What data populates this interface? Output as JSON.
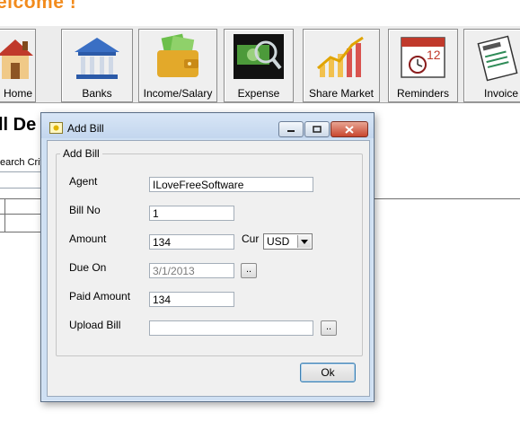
{
  "header": {
    "welcome_text": "elcome !"
  },
  "toolbar": {
    "buttons": [
      {
        "label": "Home",
        "icon": "house-icon"
      },
      {
        "label": "Banks",
        "icon": "bank-icon"
      },
      {
        "label": "Income/Salary",
        "icon": "wallet-icon"
      },
      {
        "label": "Expense",
        "icon": "money-magnifier-icon"
      },
      {
        "label": "Share Market",
        "icon": "stock-chart-icon"
      },
      {
        "label": "Reminders",
        "icon": "calendar-clock-icon"
      },
      {
        "label": "Invoice",
        "icon": "invoice-icon"
      }
    ]
  },
  "page": {
    "title": "ll De",
    "search_label": "earch Crit"
  },
  "dialog": {
    "title": "Add Bill",
    "group_label": "Add Bill",
    "fields": {
      "agent_label": "Agent",
      "agent_value": "ILoveFreeSoftware",
      "bill_no_label": "Bill No",
      "bill_no_value": "1",
      "amount_label": "Amount",
      "amount_value": "134",
      "cur_label": "Cur",
      "cur_value": "USD",
      "due_on_label": "Due On",
      "due_on_value": "3/1/2013",
      "paid_amount_label": "Paid Amount",
      "paid_amount_value": "134",
      "upload_bill_label": "Upload Bill",
      "upload_bill_value": "",
      "browse_label": ".."
    },
    "ok_label": "Ok"
  },
  "colors": {
    "welcome": "#f28b1c",
    "dialog_frame": "#cfe0f3",
    "client_bg": "#f0f0f0"
  }
}
